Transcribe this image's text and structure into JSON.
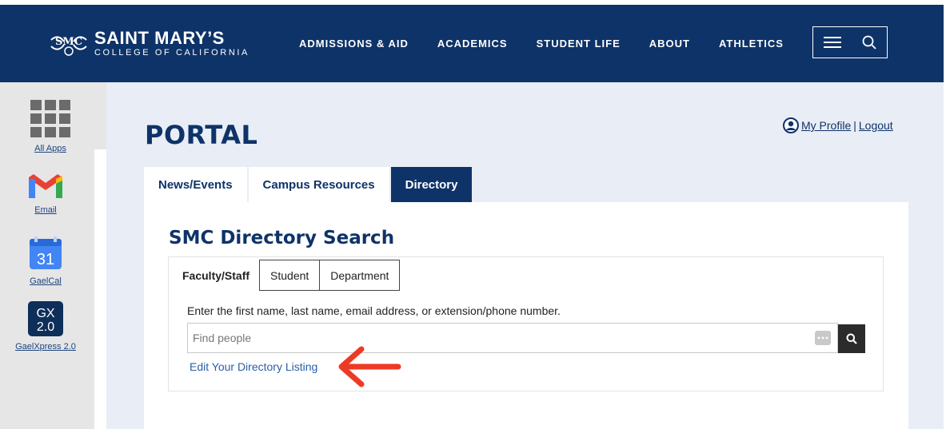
{
  "header": {
    "logo": {
      "name": "SAINT MARY’S",
      "subtitle": "COLLEGE OF CALIFORNIA",
      "mark_icon": "smc-seal-icon"
    },
    "nav": [
      "ADMISSIONS & AID",
      "ACADEMICS",
      "STUDENT LIFE",
      "ABOUT",
      "ATHLETICS"
    ],
    "menu_icon": "hamburger-icon",
    "search_icon": "search-icon"
  },
  "sidebar": {
    "apps": [
      {
        "label": "All Apps",
        "icon": "app-grid-icon"
      },
      {
        "label": "Email",
        "icon": "gmail-icon"
      },
      {
        "label": "GaelCal",
        "icon": "calendar-icon",
        "icon_text": "31"
      },
      {
        "label": "GaelXpress 2.0",
        "icon": "gaelxpress-icon",
        "icon_text_top": "GX",
        "icon_text_bottom": "2.0"
      }
    ]
  },
  "page": {
    "title": "PORTAL",
    "profile_link": "My Profile",
    "separator": "|",
    "logout_link": "Logout",
    "tabs": [
      {
        "label": "News/Events",
        "active": false
      },
      {
        "label": "Campus Resources",
        "active": false
      },
      {
        "label": "Directory",
        "active": true
      }
    ]
  },
  "directory": {
    "title": "SMC Directory Search",
    "subtabs": [
      {
        "label": "Faculty/Staff",
        "active": true
      },
      {
        "label": "Student",
        "active": false
      },
      {
        "label": "Department",
        "active": false
      }
    ],
    "instructions": "Enter the first name, last name, email address, or extension/phone number.",
    "search_placeholder": "Find people",
    "edit_link": "Edit Your Directory Listing"
  },
  "colors": {
    "brand_navy": "#0e3368",
    "page_bg": "#e9edf5",
    "sidebar_bg": "#e6e6e6",
    "link_blue": "#2a5fa8",
    "annotation_red": "#ee3a24"
  }
}
